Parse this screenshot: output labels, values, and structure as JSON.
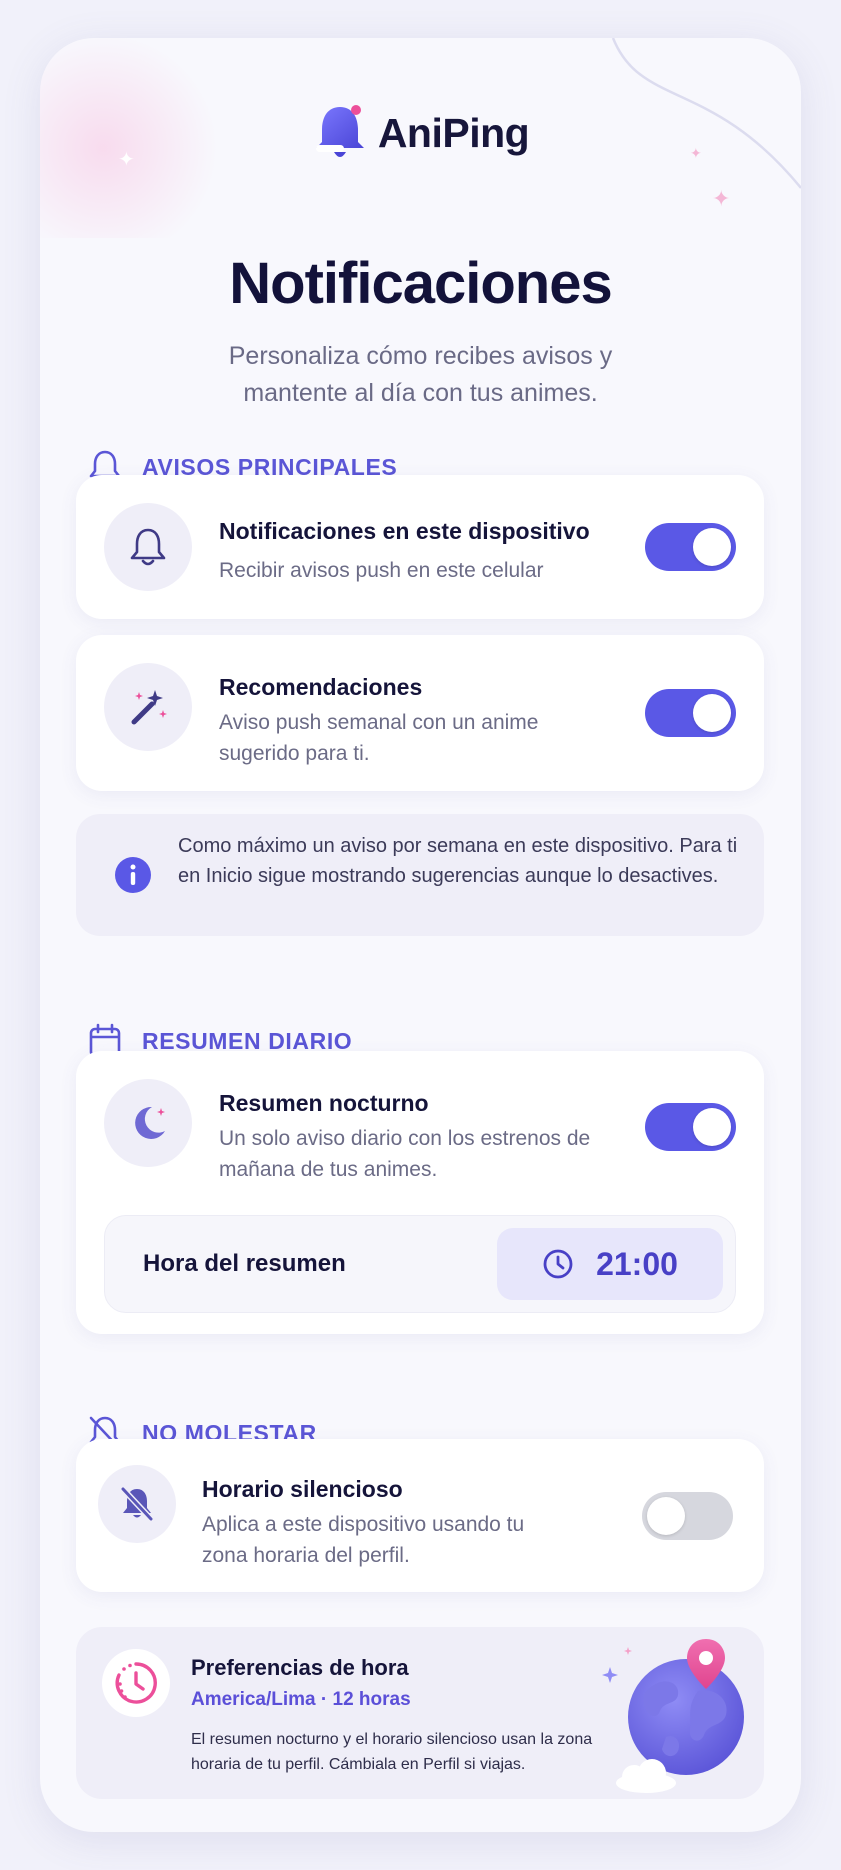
{
  "app": {
    "name": "AniPing"
  },
  "header": {
    "title": "Notificaciones",
    "subtitle": "Personaliza cómo recibes avisos y mantente al día con tus animes."
  },
  "sections": {
    "main": {
      "label": "AVISOS PRINCIPALES"
    },
    "daily": {
      "label": "RESUMEN DIARIO"
    },
    "dnd": {
      "label": "NO MOLESTAR"
    }
  },
  "settings": {
    "device": {
      "title": "Notificaciones en este dispositivo",
      "description": "Recibir avisos push en este celular",
      "enabled": true
    },
    "recommendations": {
      "title": "Recomendaciones",
      "description": "Aviso push semanal con un anime sugerido para ti.",
      "enabled": true
    },
    "nightly": {
      "title": "Resumen nocturno",
      "description": "Un solo aviso diario con los estrenos de mañana de tus animes.",
      "enabled": true
    },
    "quiet_hours": {
      "title": "Horario silencioso",
      "description": "Aplica a este dispositivo usando tu zona horaria del perfil.",
      "enabled": false
    }
  },
  "info": {
    "text": "Como máximo un aviso por semana en este dispositivo. Para ti en Inicio sigue mostrando sugerencias aunque lo desactives."
  },
  "summary_time": {
    "label": "Hora del resumen",
    "value": "21:00"
  },
  "time_prefs": {
    "title": "Preferencias de hora",
    "zone": "America/Lima · 12 horas",
    "description": "El resumen nocturno y el horario silencioso usan la zona horaria de tu perfil. Cámbiala en Perfil si viajas."
  },
  "colors": {
    "accent": "#5a58e6",
    "accent_text": "#5b56d6",
    "pink": "#ec4f9a",
    "toggle_off": "#d6d7de",
    "background": "#f1f1fa"
  },
  "icons": {
    "logo": "bell-logo-icon",
    "main_section": "bell-outline-icon",
    "daily_section": "calendar-icon",
    "dnd_section": "bell-off-icon",
    "device": "bell-icon",
    "recommendations": "magic-wand-icon",
    "nightly": "moon-icon",
    "quiet_hours": "bell-slash-icon",
    "info": "info-icon",
    "time": "clock-icon",
    "time_prefs": "clock-history-icon",
    "illustration": "globe-pin-icon"
  }
}
